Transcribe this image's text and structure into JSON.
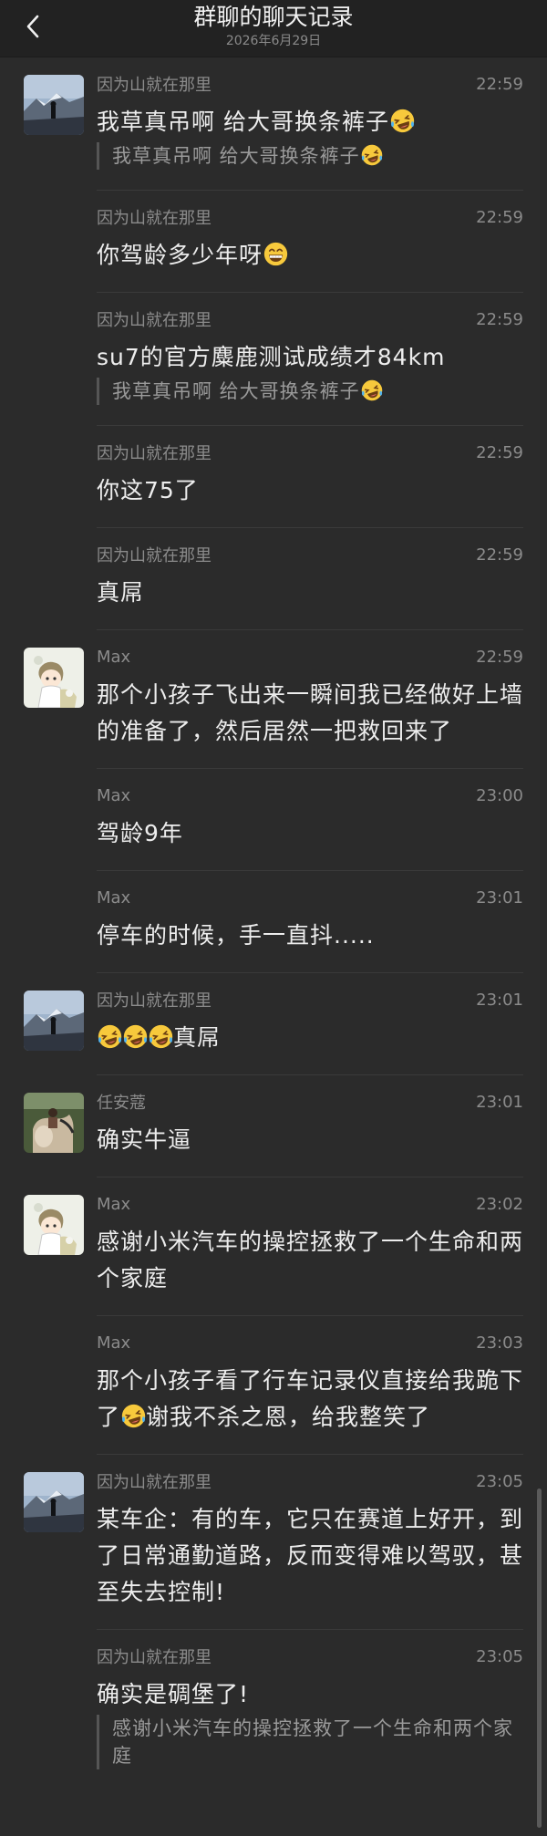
{
  "header": {
    "title": "群聊的聊天记录",
    "date": "2026年6月29日",
    "back_icon": "chevron-left-icon"
  },
  "colors": {
    "background": "#2b2b2b",
    "header_bg": "#222222",
    "text": "#ededed",
    "meta": "#8b8b8b",
    "quote": "#9a9a9a"
  },
  "messages": [
    {
      "sender": "因为山就在那里",
      "time": "22:59",
      "avatar": "mountain",
      "parts": [
        {
          "t": "我草真吊啊  给大哥换条裤子"
        },
        {
          "e": "laugh-cry"
        }
      ],
      "quote": [
        {
          "t": "我草真吊啊  给大哥换条裤子"
        },
        {
          "e": "laugh-cry"
        }
      ]
    },
    {
      "sender": "因为山就在那里",
      "time": "22:59",
      "avatar": null,
      "parts": [
        {
          "t": "你驾龄多少年呀"
        },
        {
          "e": "grin"
        }
      ]
    },
    {
      "sender": "因为山就在那里",
      "time": "22:59",
      "avatar": null,
      "parts": [
        {
          "t": "su7的官方麋鹿测试成绩才84km"
        }
      ],
      "quote": [
        {
          "t": "我草真吊啊  给大哥换条裤子"
        },
        {
          "e": "laugh-cry"
        }
      ]
    },
    {
      "sender": "因为山就在那里",
      "time": "22:59",
      "avatar": null,
      "parts": [
        {
          "t": "你这75了"
        }
      ]
    },
    {
      "sender": "因为山就在那里",
      "time": "22:59",
      "avatar": null,
      "parts": [
        {
          "t": "真屌"
        }
      ]
    },
    {
      "sender": "Max",
      "time": "22:59",
      "avatar": "anime",
      "parts": [
        {
          "t": "那个小孩子飞出来一瞬间我已经做好上墙的准备了，然后居然一把救回来了"
        }
      ]
    },
    {
      "sender": "Max",
      "time": "23:00",
      "avatar": null,
      "parts": [
        {
          "t": "驾龄9年"
        }
      ]
    },
    {
      "sender": "Max",
      "time": "23:01",
      "avatar": null,
      "parts": [
        {
          "t": "停车的时候，手一直抖....."
        }
      ]
    },
    {
      "sender": "因为山就在那里",
      "time": "23:01",
      "avatar": "mountain",
      "parts": [
        {
          "e": "laugh-cry"
        },
        {
          "e": "laugh-cry"
        },
        {
          "e": "laugh-cry"
        },
        {
          "t": "真屌"
        }
      ]
    },
    {
      "sender": "任安蔻",
      "time": "23:01",
      "avatar": "horse",
      "parts": [
        {
          "t": "确实牛逼"
        }
      ]
    },
    {
      "sender": "Max",
      "time": "23:02",
      "avatar": "anime",
      "parts": [
        {
          "t": "感谢小米汽车的操控拯救了一个生命和两个家庭"
        }
      ]
    },
    {
      "sender": "Max",
      "time": "23:03",
      "avatar": null,
      "parts": [
        {
          "t": "那个小孩子看了行车记录仪直接给我跪下了"
        },
        {
          "e": "laugh-cry"
        },
        {
          "t": "谢我不杀之恩，给我整笑了"
        }
      ]
    },
    {
      "sender": "因为山就在那里",
      "time": "23:05",
      "avatar": "mountain",
      "parts": [
        {
          "t": "某车企：有的车，它只在赛道上好开，到了日常通勤道路，反而变得难以驾驭，甚至失去控制!"
        }
      ]
    },
    {
      "sender": "因为山就在那里",
      "time": "23:05",
      "avatar": null,
      "parts": [
        {
          "t": "确实是碉堡了!"
        }
      ],
      "quote": [
        {
          "t": "感谢小米汽车的操控拯救了一个生命和两个家庭"
        }
      ]
    }
  ]
}
